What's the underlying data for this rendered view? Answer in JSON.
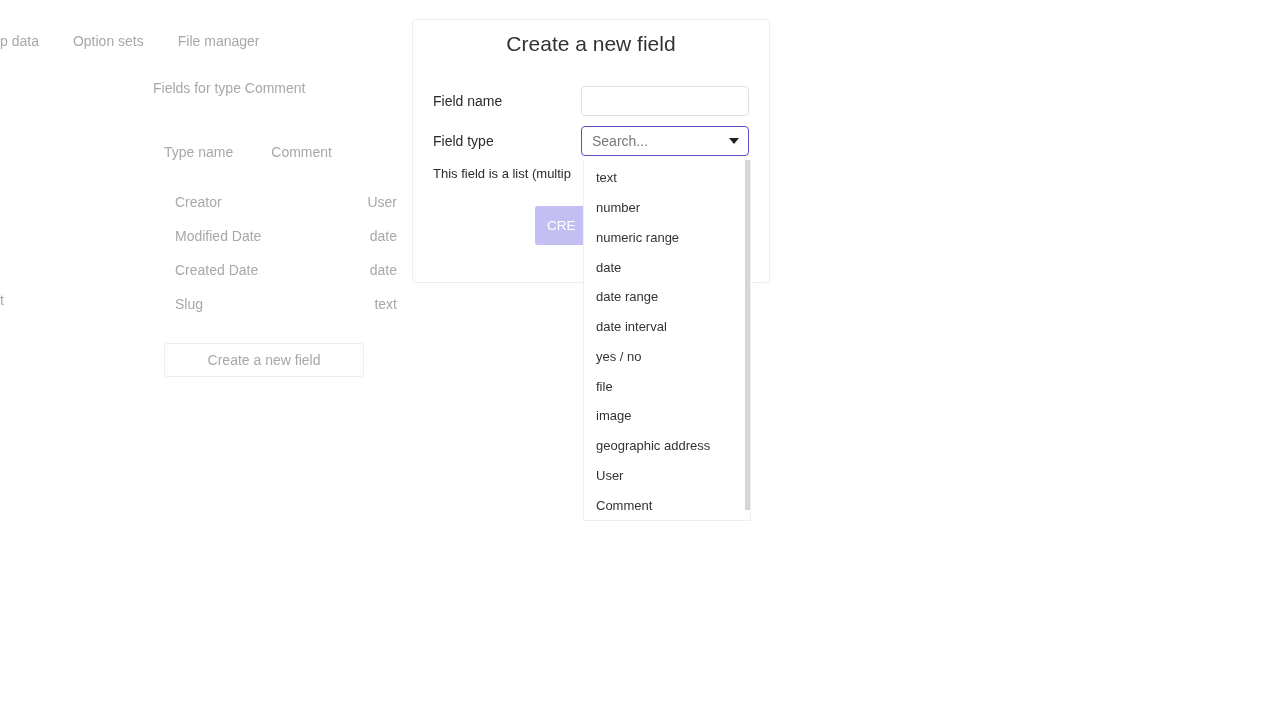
{
  "background": {
    "tabs": [
      "p data",
      "Option sets",
      "File manager"
    ],
    "heading": "Fields for type Comment",
    "side_text": "t",
    "type_name_label": "Type name",
    "type_name_value": "Comment",
    "fields": [
      {
        "name": "Creator",
        "type": "User"
      },
      {
        "name": "Modified Date",
        "type": "date"
      },
      {
        "name": "Created Date",
        "type": "date"
      },
      {
        "name": "Slug",
        "type": "text"
      }
    ],
    "new_field_button": "Create a new field"
  },
  "dialog": {
    "title": "Create a new field",
    "field_name": {
      "label": "Field name"
    },
    "field_type": {
      "label": "Field type",
      "placeholder": "Search...",
      "expanded": true
    },
    "list_label": "This field is a list (multip",
    "create_button": "CRE",
    "options": [
      "text",
      "number",
      "numeric range",
      "date",
      "date range",
      "date interval",
      "yes / no",
      "file",
      "image",
      "geographic address",
      "User",
      "Comment"
    ]
  }
}
